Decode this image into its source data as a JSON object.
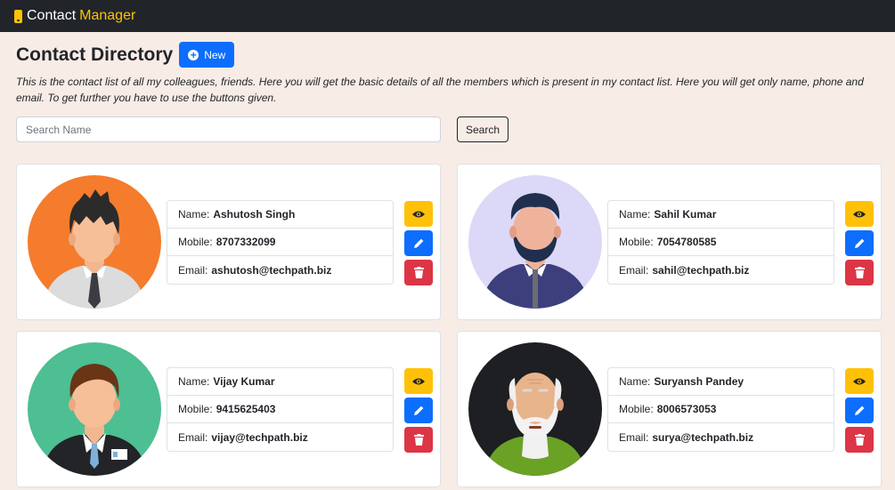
{
  "navbar": {
    "brand_main": "Contact",
    "brand_accent": "Manager",
    "brand_icon": "phone-icon"
  },
  "header": {
    "title": "Contact Directory",
    "new_label": "New",
    "description": "This is the contact list of all my colleagues, friends. Here you will get the basic details of all the members which is present in my contact list. Here you will get only name, phone and email. To get further you have to use the buttons given."
  },
  "search": {
    "placeholder": "Search Name",
    "value": "",
    "button_label": "Search"
  },
  "labels": {
    "name": "Name:",
    "mobile": "Mobile:",
    "email": "Email:"
  },
  "icons": {
    "view": "eye-icon",
    "edit": "pencil-icon",
    "delete": "trash-icon"
  },
  "colors": {
    "navbar": "#212529",
    "accent": "#ffc107",
    "primary": "#0d6efd",
    "danger": "#dc3545",
    "page_bg": "#f8ece6"
  },
  "contacts": [
    {
      "name": "Ashutosh Singh",
      "mobile": "8707332099",
      "email": "ashutosh@techpath.biz",
      "avatar_bg": "#f47c2c"
    },
    {
      "name": "Sahil Kumar",
      "mobile": "7054780585",
      "email": "sahil@techpath.biz",
      "avatar_bg": "#dcd8f7"
    },
    {
      "name": "Vijay Kumar",
      "mobile": "9415625403",
      "email": "vijay@techpath.biz",
      "avatar_bg": "#4dbf92"
    },
    {
      "name": "Suryansh Pandey",
      "mobile": "8006573053",
      "email": "surya@techpath.biz",
      "avatar_bg": "#1d1f22"
    }
  ]
}
